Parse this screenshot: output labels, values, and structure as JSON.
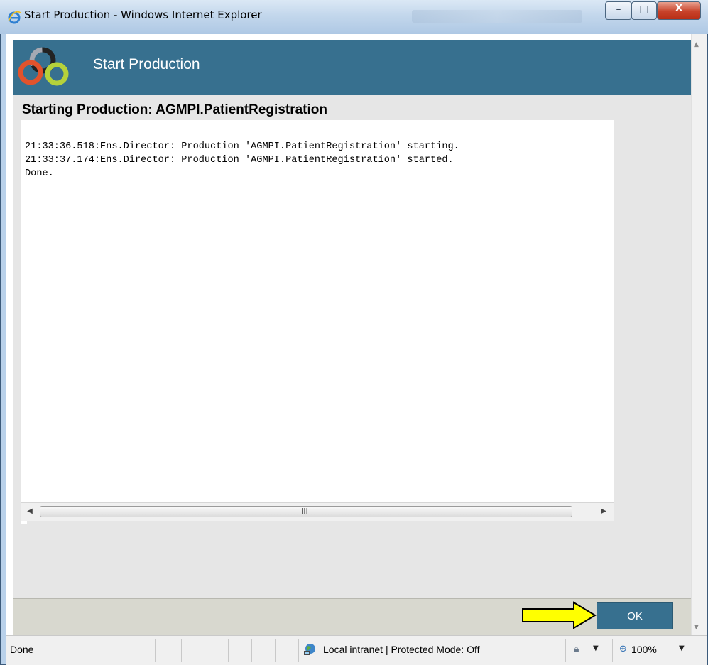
{
  "window": {
    "title": "Start Production - Windows Internet Explorer",
    "buttons": {
      "minimize": "–",
      "maximize": "□",
      "close": "X"
    }
  },
  "header": {
    "title": "Start Production"
  },
  "content": {
    "subtitle": "Starting Production:  AGMPI.PatientRegistration",
    "log_lines": [
      "21:33:36.518:Ens.Director: Production 'AGMPI.PatientRegistration' starting.",
      "21:33:37.174:Ens.Director: Production 'AGMPI.PatientRegistration' started.",
      "Done."
    ]
  },
  "scrollbar": {
    "left": "◀",
    "right": "▶",
    "grip": "III",
    "up": "▲",
    "down": "▼"
  },
  "buttons": {
    "ok": "OK"
  },
  "statusbar": {
    "status": "Done",
    "zone": "Local intranet | Protected Mode: Off",
    "zoom": "100%",
    "caret": "▼"
  },
  "colors": {
    "header": "#37708f",
    "pointer_arrow": "#ffff00"
  }
}
